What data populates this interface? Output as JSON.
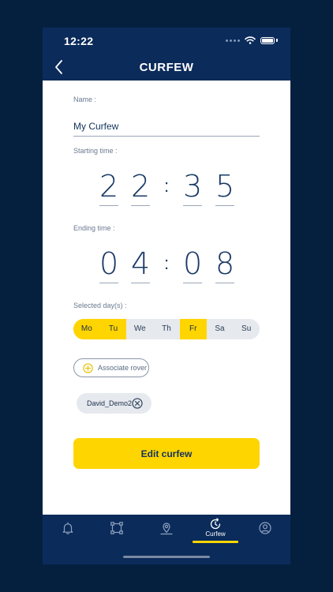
{
  "status": {
    "time": "12:22"
  },
  "nav": {
    "title": "CURFEW"
  },
  "form": {
    "name_label": "Name :",
    "name_value": "My Curfew",
    "start_label": "Starting time :",
    "start_digits": [
      "2",
      "2",
      "3",
      "5"
    ],
    "end_label": "Ending time :",
    "end_digits": [
      "0",
      "4",
      "0",
      "8"
    ],
    "colon": ":",
    "days_label": "Selected day(s) :",
    "days": [
      {
        "label": "Mo",
        "selected": true
      },
      {
        "label": "Tu",
        "selected": true
      },
      {
        "label": "We",
        "selected": false
      },
      {
        "label": "Th",
        "selected": false
      },
      {
        "label": "Fr",
        "selected": true
      },
      {
        "label": "Sa",
        "selected": false
      },
      {
        "label": "Su",
        "selected": false
      }
    ],
    "associate_label": "Associate rover",
    "rover_chip": "David_Demo2",
    "submit_label": "Edit curfew"
  },
  "tabs": [
    {
      "icon": "bell-icon",
      "label": ""
    },
    {
      "icon": "geofence-icon",
      "label": ""
    },
    {
      "icon": "map-pin-icon",
      "label": ""
    },
    {
      "icon": "curfew-clock-icon",
      "label": "Curfew",
      "active": true
    },
    {
      "icon": "user-icon",
      "label": ""
    }
  ],
  "colors": {
    "accent": "#ffd500",
    "navy": "#0b2b5a",
    "background": "#05203f"
  }
}
